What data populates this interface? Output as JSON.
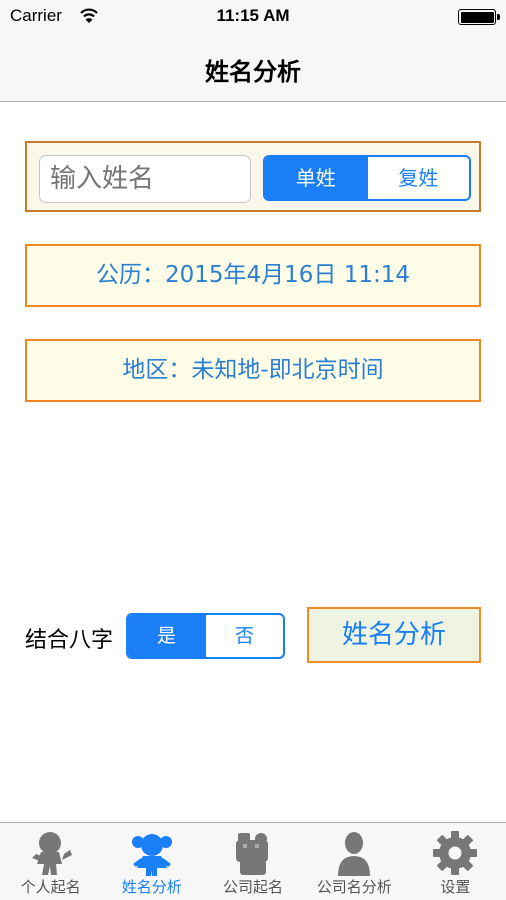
{
  "status_bar": {
    "carrier": "Carrier",
    "time": "11:15 AM"
  },
  "nav": {
    "title": "姓名分析"
  },
  "name_input": {
    "placeholder": "输入姓名"
  },
  "surname_type": {
    "options": [
      "单姓",
      "复姓"
    ],
    "selected": "单姓"
  },
  "birth_date": {
    "text": "公历：2015年4月16日 11:14"
  },
  "region": {
    "text": "地区：未知地-即北京时间"
  },
  "bazi": {
    "label": "结合八字",
    "options": [
      "是",
      "否"
    ],
    "selected": "是"
  },
  "analyze_button": {
    "label": "姓名分析"
  },
  "tabs": [
    {
      "label": "个人起名",
      "icon": "child-icon"
    },
    {
      "label": "姓名分析",
      "icon": "girl-icon"
    },
    {
      "label": "公司起名",
      "icon": "company-icon"
    },
    {
      "label": "公司名分析",
      "icon": "person-icon"
    },
    {
      "label": "设置",
      "icon": "gear-icon"
    }
  ],
  "active_tab": "姓名分析",
  "colors": {
    "accent": "#1a7ff7",
    "box_border": "#ee8822",
    "box_fill": "#fffde8",
    "box_text": "#2a7fd0"
  }
}
